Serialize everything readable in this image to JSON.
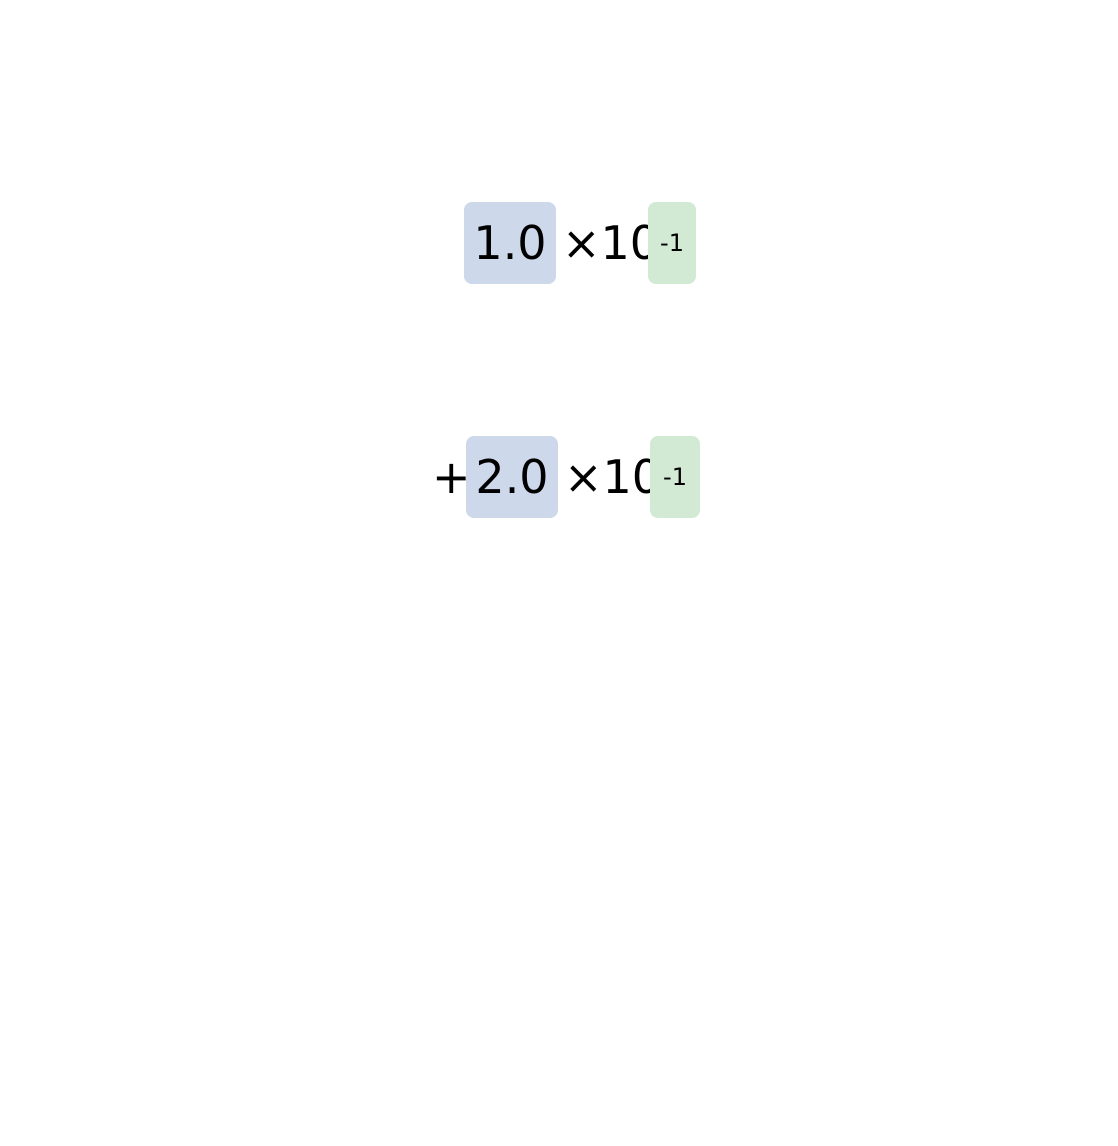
{
  "colors": {
    "mantissa_bg": "#cdd8eb",
    "exponent_bg": "#d2e9d4",
    "text": "#000000",
    "background": "#ffffff"
  },
  "terms": [
    {
      "operator": "",
      "mantissa": "1.0",
      "base": "×10",
      "exponent": "-1"
    },
    {
      "operator": "+",
      "mantissa": "2.0",
      "base": "×10",
      "exponent": "-1"
    }
  ]
}
